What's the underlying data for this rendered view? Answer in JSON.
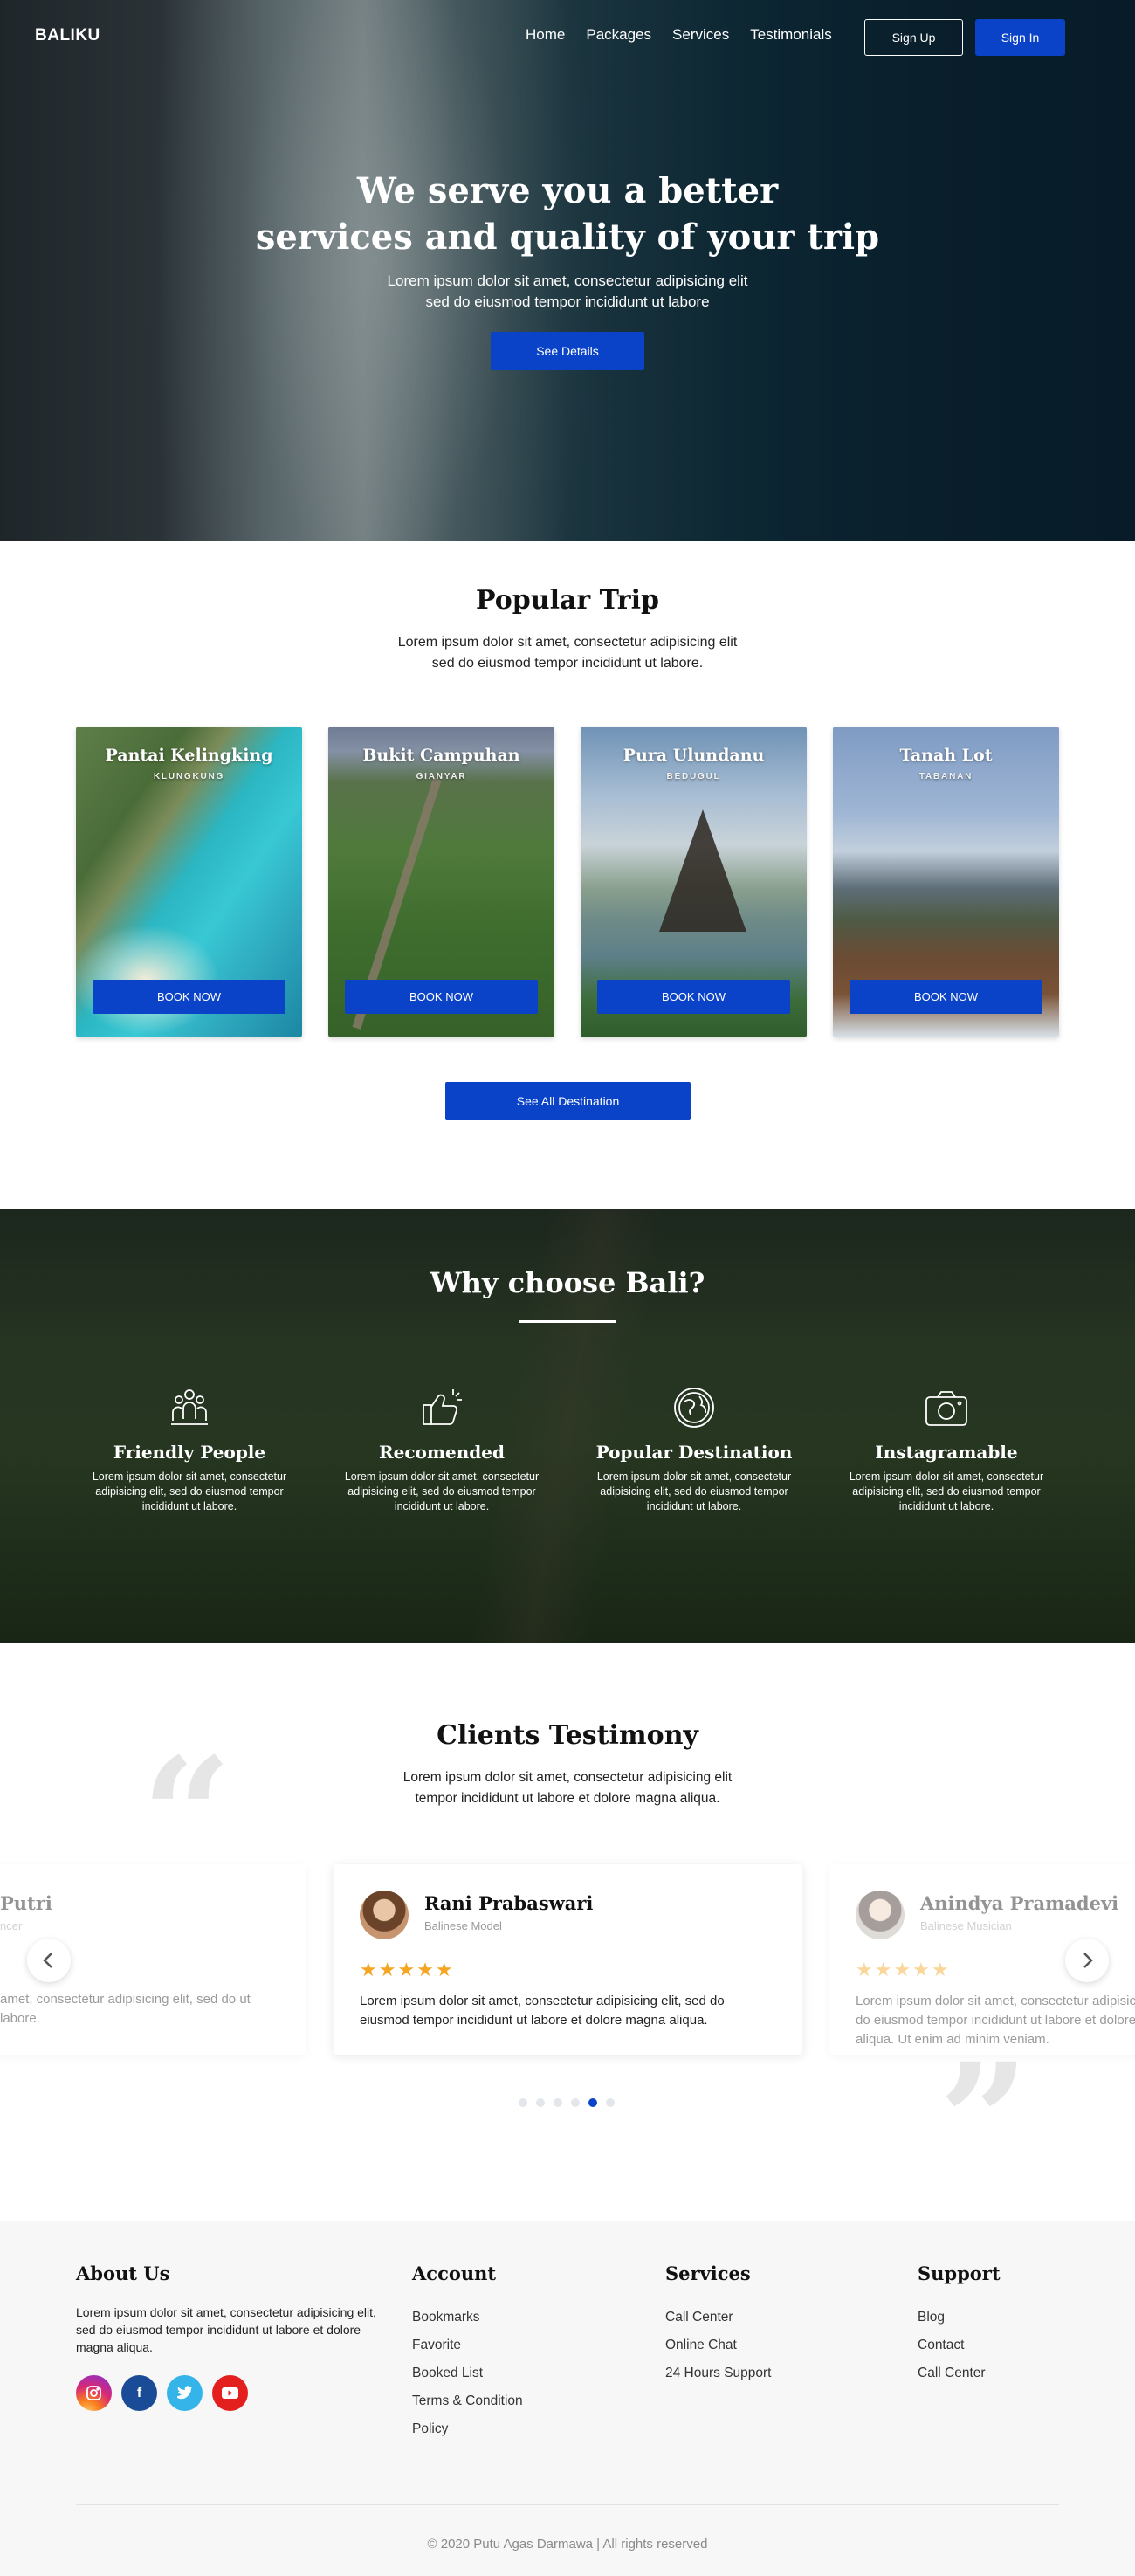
{
  "nav": {
    "brand": "BALIKU",
    "links": [
      "Home",
      "Packages",
      "Services",
      "Testimonials"
    ],
    "signup": "Sign Up",
    "signin": "Sign In"
  },
  "hero": {
    "title_line1": "We serve you a better",
    "title_line2": "services and quality of your trip",
    "sub_line1": "Lorem ipsum dolor sit amet, consectetur adipisicing elit",
    "sub_line2": "sed do eiusmod tempor incididunt ut labore",
    "button": "See Details"
  },
  "popular": {
    "title": "Popular Trip",
    "sub_line1": "Lorem ipsum dolor sit amet, consectetur adipisicing elit",
    "sub_line2": "sed do eiusmod tempor incididunt ut labore.",
    "cards": [
      {
        "name": "Pantai Kelingking",
        "location": "KLUNGKUNG",
        "button": "BOOK NOW"
      },
      {
        "name": "Bukit Campuhan",
        "location": "GIANYAR",
        "button": "BOOK NOW"
      },
      {
        "name": "Pura Ulundanu",
        "location": "BEDUGUL",
        "button": "BOOK NOW"
      },
      {
        "name": "Tanah Lot",
        "location": "TABANAN",
        "button": "BOOK NOW"
      }
    ],
    "see_all": "See All Destination"
  },
  "why": {
    "title": "Why choose Bali?",
    "features": [
      {
        "icon": "people-icon",
        "title": "Friendly People",
        "desc": "Lorem ipsum dolor sit amet, consectetur adipisicing elit, sed do eiusmod tempor incididunt ut labore."
      },
      {
        "icon": "thumbs-up-icon",
        "title": "Recomended",
        "desc": "Lorem ipsum dolor sit amet, consectetur adipisicing elit, sed do eiusmod tempor incididunt ut labore."
      },
      {
        "icon": "globe-icon",
        "title": "Popular Destination",
        "desc": "Lorem ipsum dolor sit amet, consectetur adipisicing elit, sed do eiusmod tempor incididunt ut labore."
      },
      {
        "icon": "camera-icon",
        "title": "Instagramable",
        "desc": "Lorem ipsum dolor sit amet, consectetur adipisicing elit, sed do eiusmod tempor incididunt ut labore."
      }
    ]
  },
  "testimony": {
    "title": "Clients Testimony",
    "sub_line1": "Lorem ipsum dolor sit amet, consectetur adipisicing elit",
    "sub_line2": "tempor incididunt ut labore et dolore magna aliqua.",
    "stars": "★★★★★",
    "items": [
      {
        "name": "Putri",
        "role": "ncer",
        "text": "amet, consectetur adipisicing elit, sed do ut labore."
      },
      {
        "name": "Rani Prabaswari",
        "role": "Balinese Model",
        "text": "Lorem ipsum dolor sit amet, consectetur adipisicing elit, sed do eiusmod tempor incididunt ut labore et dolore magna aliqua."
      },
      {
        "name": "Anindya Pramadevi",
        "role": "Balinese Musician",
        "text": "Lorem ipsum dolor sit amet, consectetur adipisicing elit, sed do eiusmod tempor incididunt ut labore et dolore magna aliqua. Ut enim ad minim veniam."
      }
    ],
    "active_dot": 5,
    "dot_count": 6
  },
  "footer": {
    "about": {
      "title": "About Us",
      "text": "Lorem ipsum dolor sit amet, consectetur adipisicing elit, sed do eiusmod tempor incididunt ut labore et dolore magna aliqua.",
      "socials": [
        "instagram-icon",
        "facebook-icon",
        "twitter-icon",
        "youtube-icon"
      ]
    },
    "account": {
      "title": "Account",
      "items": [
        "Bookmarks",
        "Favorite",
        "Booked List",
        "Terms & Condition",
        "Policy"
      ]
    },
    "services": {
      "title": "Services",
      "items": [
        "Call Center",
        "Online Chat",
        "24 Hours Support"
      ]
    },
    "support": {
      "title": "Support",
      "items": [
        "Blog",
        "Contact",
        "Call Center"
      ]
    },
    "copyright": "© 2020 Putu Agas Darmawa | All rights reserved"
  },
  "colors": {
    "accent": "#0a43c8",
    "star": "#f4a622",
    "footer_bg": "#f7f7f7"
  }
}
